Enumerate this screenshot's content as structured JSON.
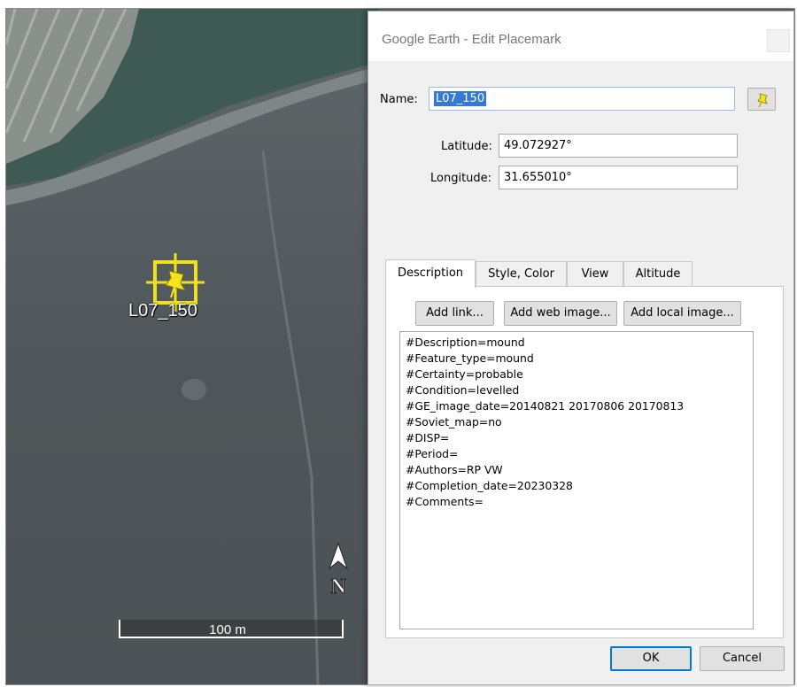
{
  "map": {
    "placemark_label": "L07_150",
    "scale_label": "100 m",
    "compass_letter": "N"
  },
  "dialog": {
    "title": "Google Earth - Edit Placemark",
    "name_label": "Name:",
    "name_value": "L07_150",
    "latitude_label": "Latitude:",
    "latitude_value": "49.072927°",
    "longitude_label": "Longitude:",
    "longitude_value": "31.655010°",
    "tabs": [
      {
        "label": "Description",
        "active": true
      },
      {
        "label": "Style, Color",
        "active": false
      },
      {
        "label": "View",
        "active": false
      },
      {
        "label": "Altitude",
        "active": false
      }
    ],
    "buttons": {
      "add_link": "Add link...",
      "add_web_image": "Add web image...",
      "add_local_image": "Add local image...",
      "ok": "OK",
      "cancel": "Cancel"
    },
    "description_lines": [
      "#Description=mound",
      "#Feature_type=mound",
      "#Certainty=probable",
      "#Condition=levelled",
      "#GE_image_date=20140821 20170806 20170813",
      "#Soviet_map=no",
      "#DISP=",
      "#Period=",
      "#Authors=RP VW",
      "#Completion_date=20230328",
      "#Comments="
    ],
    "icons": {
      "pin_button": "yellow-pushpin-icon",
      "close": "close-icon"
    }
  },
  "colors": {
    "highlight_yellow": "#f0e21a",
    "selection_blue": "#3579d8",
    "ok_border": "#0078d7"
  }
}
